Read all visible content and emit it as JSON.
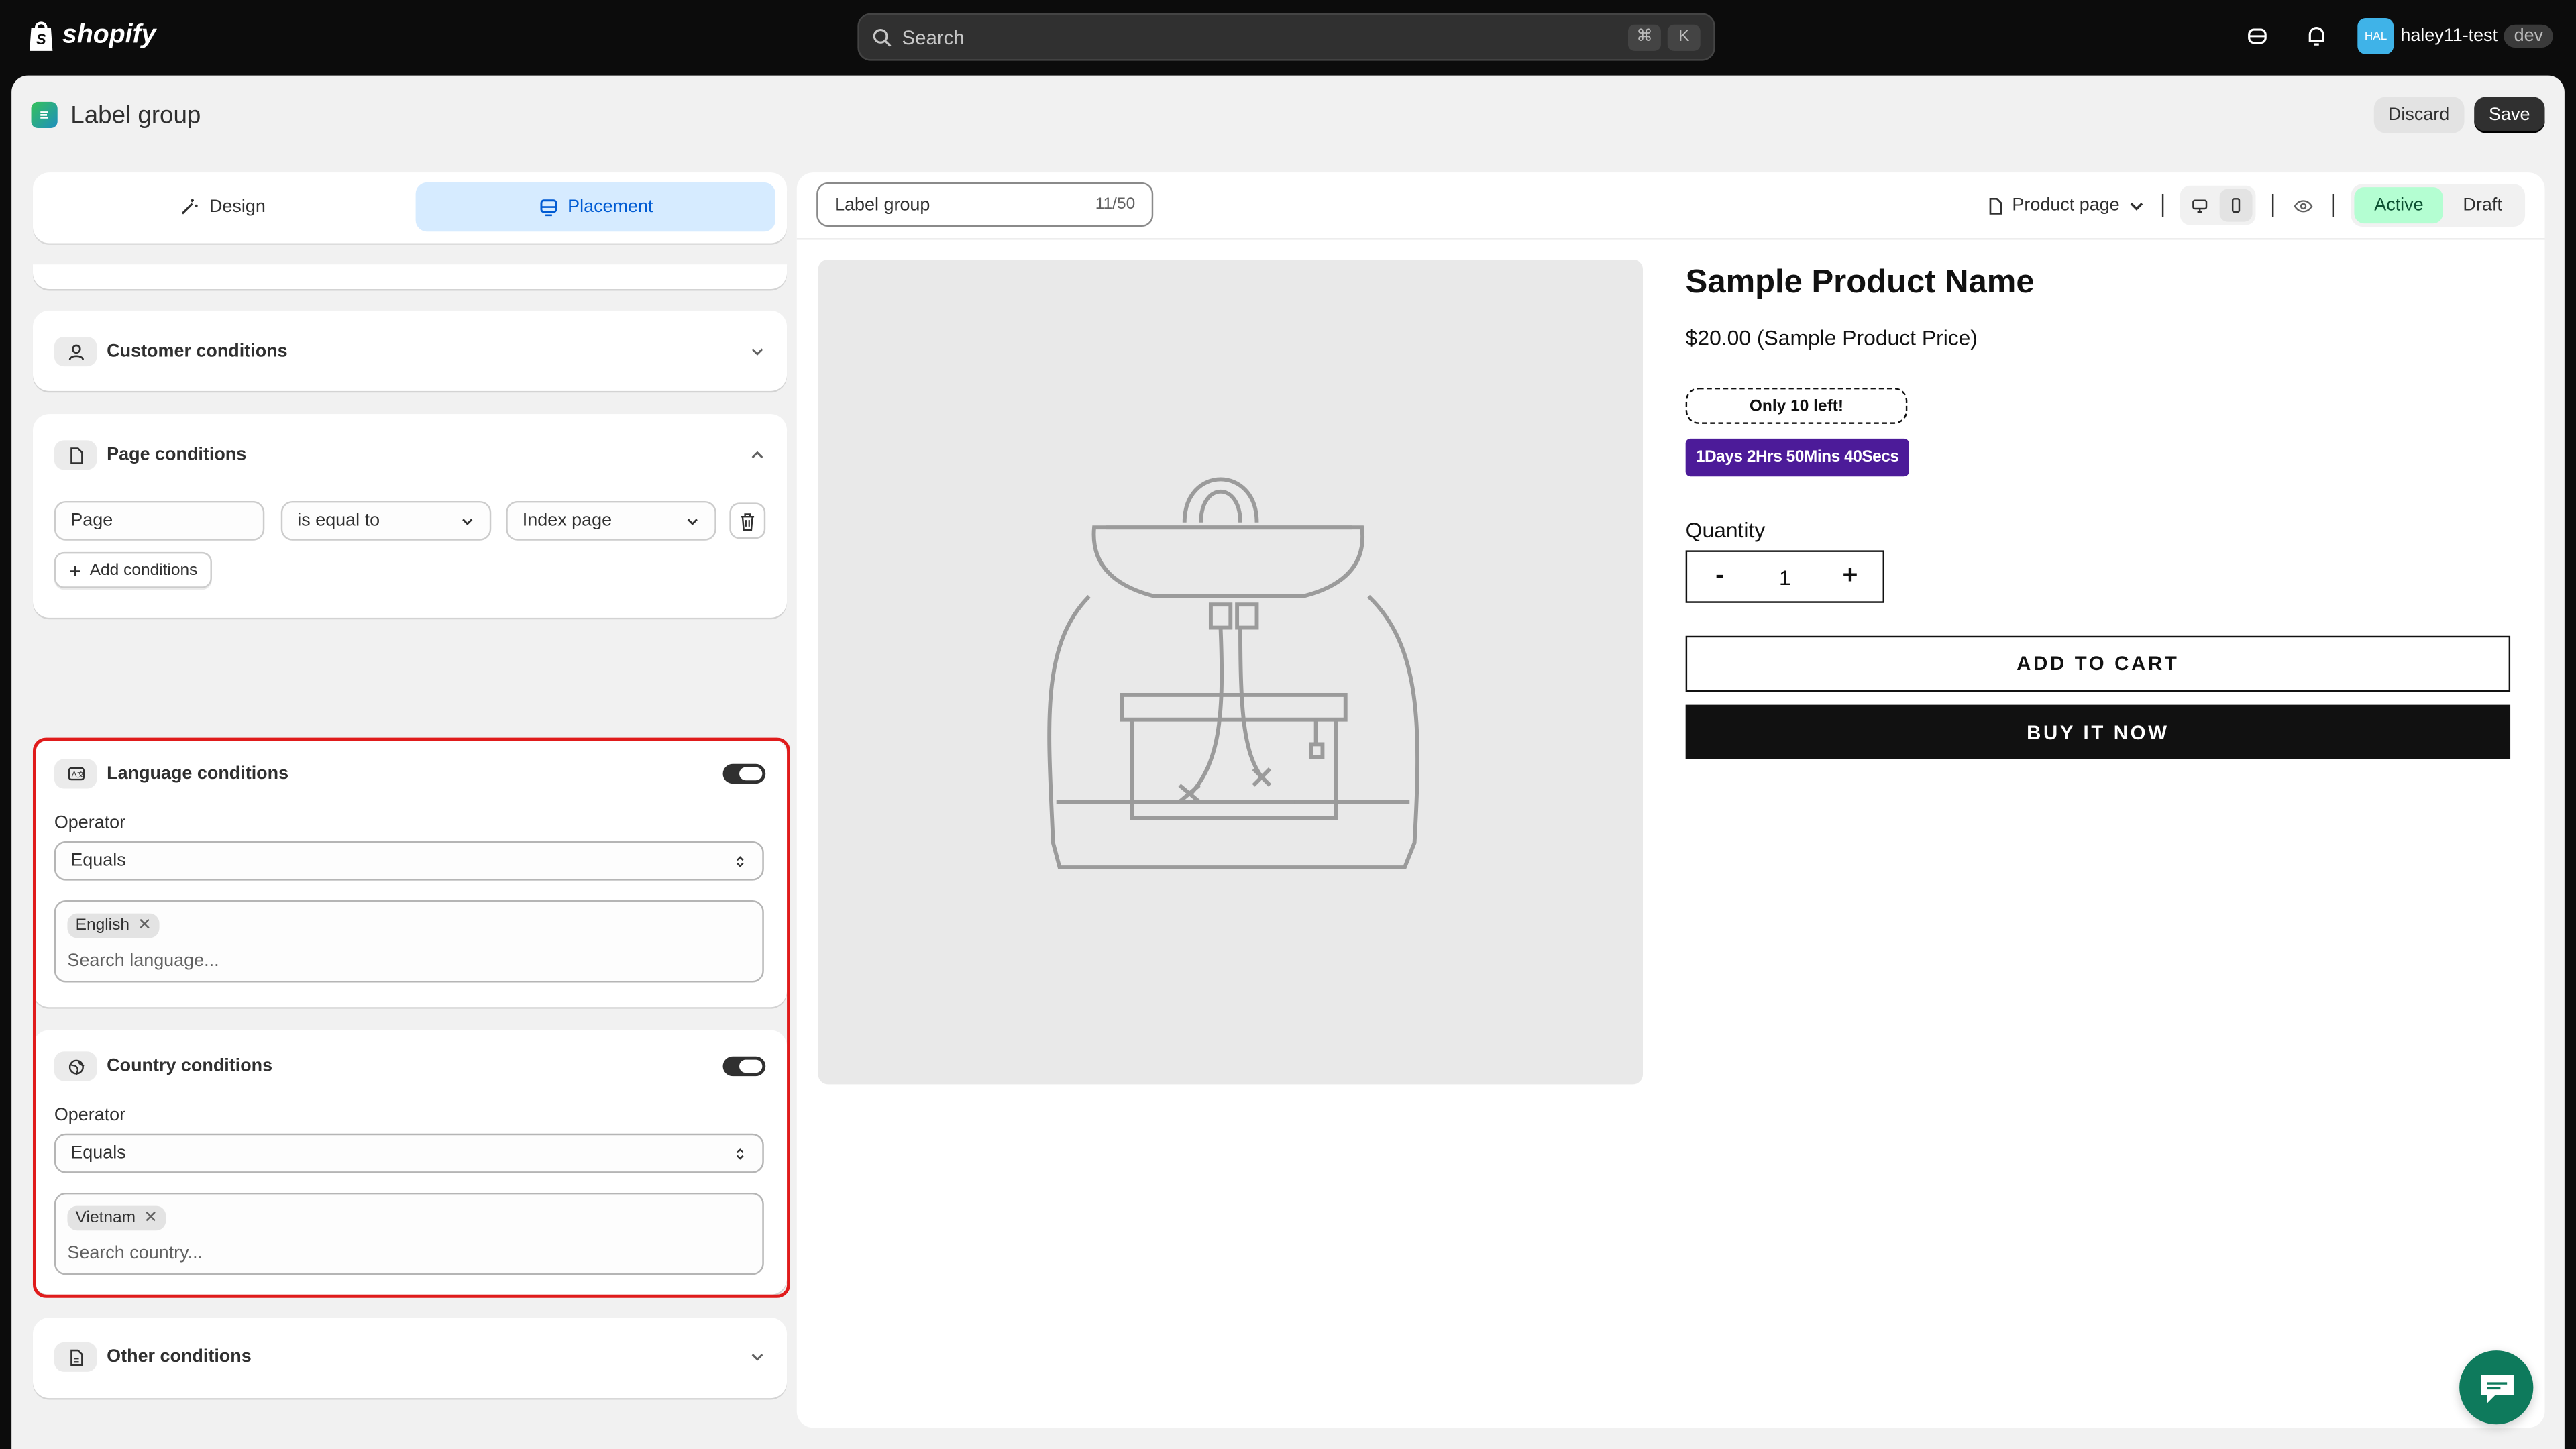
{
  "topbar": {
    "brand": "shopify",
    "search_placeholder": "Search",
    "shortcut_key1": "⌘",
    "shortcut_key2": "K",
    "avatar_initials": "HAL",
    "username": "haley11-test",
    "env_badge": "dev"
  },
  "page": {
    "title": "Label group",
    "discard_label": "Discard",
    "save_label": "Save"
  },
  "tabs": {
    "design": "Design",
    "placement": "Placement"
  },
  "conditions": {
    "customer": "Customer conditions",
    "page": {
      "title": "Page conditions",
      "field": "Page",
      "operator": "is equal to",
      "value": "Index page",
      "add_label": "Add conditions"
    },
    "language": {
      "title": "Language conditions",
      "operator_label": "Operator",
      "operator_value": "Equals",
      "tag": "English",
      "search_placeholder": "Search language..."
    },
    "country": {
      "title": "Country conditions",
      "operator_label": "Operator",
      "operator_value": "Equals",
      "tag": "Vietnam",
      "search_placeholder": "Search country..."
    },
    "other": "Other conditions"
  },
  "preview": {
    "name_field": "Label group",
    "name_count": "11/50",
    "page_type": "Product page",
    "status_active": "Active",
    "status_draft": "Draft",
    "product_name": "Sample Product Name",
    "product_price": "$20.00 (Sample Product Price)",
    "badge_stock": "Only 10 left!",
    "badge_timer": "1Days 2Hrs 50Mins 40Secs",
    "quantity_label": "Quantity",
    "qty_minus": "-",
    "qty_value": "1",
    "qty_plus": "+",
    "add_to_cart": "ADD TO CART",
    "buy_now": "BUY IT NOW"
  },
  "colors": {
    "accent_blue": "#005bd3",
    "active_green": "#b4fed2",
    "timer_purple": "#4c1b99",
    "highlight_red": "#e01b1b",
    "chat_green": "#0e7a5c"
  }
}
